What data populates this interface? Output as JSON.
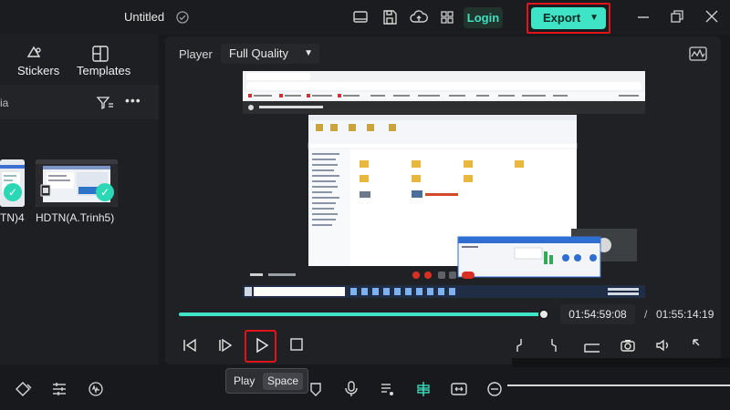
{
  "window": {
    "title": "Untitled",
    "login_label": "Login",
    "export_label": "Export"
  },
  "left_panel": {
    "tabs": [
      {
        "label": "Stickers",
        "icon": "stickers-icon"
      },
      {
        "label": "Templates",
        "icon": "templates-icon"
      }
    ],
    "sub_label_fragment": "ia",
    "media": [
      {
        "label": "TN)4"
      },
      {
        "label": "HDTN(A.Trinh5)"
      }
    ]
  },
  "player": {
    "label": "Player",
    "quality": "Full Quality",
    "current_time": "01:54:59:08",
    "separator": "/",
    "total_time": "01:55:14:19",
    "progress": 0.99
  },
  "video_content": {
    "tab_title": "rgh-yrqp-abib",
    "address": "meet.google.com/rgh-yrqp-abib",
    "banner": "CÔNG TRÌNH NGUYÊN dang trình bày",
    "meeting_time": "17:20",
    "meeting_code": "rgh-yrqp-abib",
    "taskbar_search": "Type here to search",
    "recording_title": "Recording Toolbar",
    "rec_timer": "00:00:04",
    "clock_time": "3:59 CH",
    "clock_date": "07/10/2021"
  },
  "tooltip": {
    "action": "Play",
    "shortcut": "Space"
  },
  "colors": {
    "accent": "#3fe3c5",
    "highlight": "#e0141b",
    "background": "#18191c"
  }
}
